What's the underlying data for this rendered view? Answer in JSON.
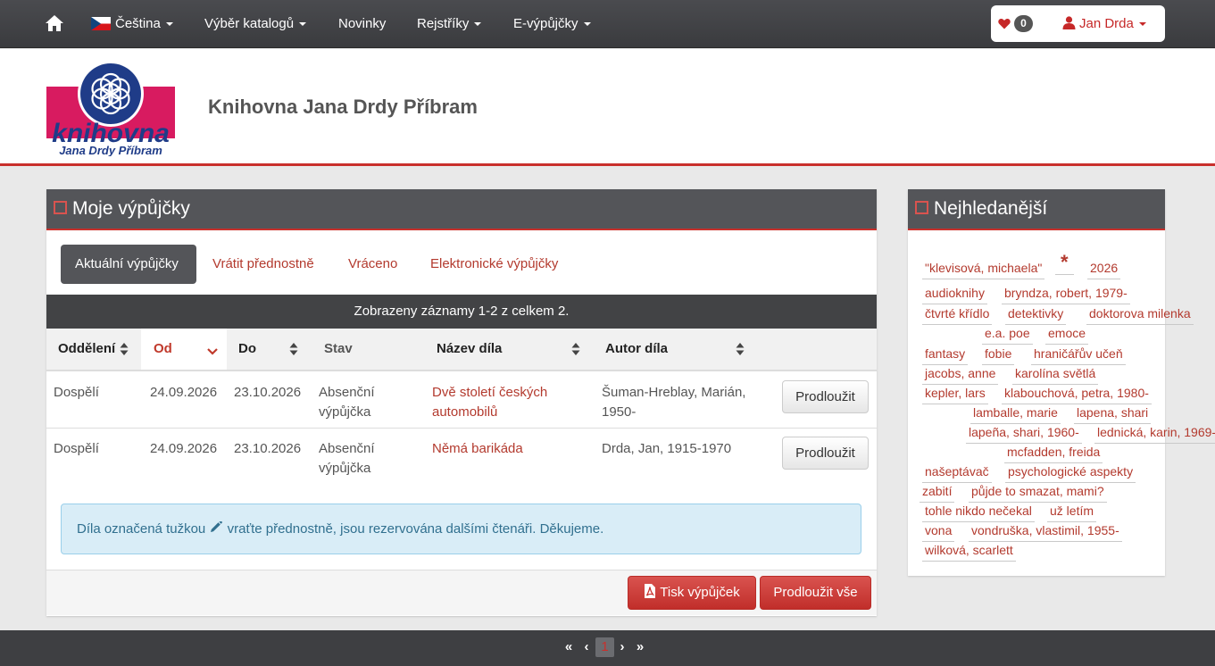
{
  "nav": {
    "language": "Čeština",
    "catalogs": "Výběr katalogů",
    "news": "Novinky",
    "indexes": "Rejstříky",
    "eloans": "E-výpůjčky",
    "favorites_count": "0",
    "user": "Jan Drda"
  },
  "header": {
    "title": "Knihovna Jana Drdy Příbram",
    "logo_text": "knihovna",
    "logo_subtext": "Jana Drdy Příbram"
  },
  "loans": {
    "panel_title": "Moje výpůjčky",
    "tabs": [
      "Aktuální výpůjčky",
      "Vrátit přednostně",
      "Vráceno",
      "Elektronické výpůjčky"
    ],
    "summary": "Zobrazeny záznamy 1-2 z celkem 2.",
    "columns": [
      "Oddělení",
      "Od",
      "Do",
      "Stav",
      "Název díla",
      "Autor díla"
    ],
    "rows": [
      {
        "dept": "Dospělí",
        "from": "24.09.2026",
        "to": "23.10.2026",
        "status": "Absenční výpůjčka",
        "title": "Dvě století českých automobilů",
        "author": "Šuman-Hreblay, Marián, 1950-",
        "action": "Prodloužit"
      },
      {
        "dept": "Dospělí",
        "from": "24.09.2026",
        "to": "23.10.2026",
        "status": "Absenční výpůjčka",
        "title": "Němá barikáda",
        "author": "Drda, Jan, 1915-1970",
        "action": "Prodloužit"
      }
    ],
    "notice_before": "Díla označená tužkou",
    "notice_after": "vraťte přednostně, jsou rezervována dalšími čtenáři. Děkujeme.",
    "print_button": "Tisk výpůjček",
    "renew_all_button": "Prodloužit vše"
  },
  "popular": {
    "panel_title": "Nejhledanější",
    "tags": [
      "\"klevisová, michaela\"",
      "*",
      "2026",
      "audioknihy",
      "bryndza, robert, 1979-",
      "čtvrté křídlo",
      "detektivky",
      "doktorova milenka",
      "e.a. poe",
      "emoce",
      "fantasy",
      "fobie",
      "hraničářův učeň",
      "jacobs, anne",
      "karolína světlá",
      "kepler, lars",
      "klabouchová, petra, 1980-",
      "lamballe, marie",
      "lapena, shari",
      "lapeña, shari, 1960-",
      "lednická, karin, 1969-",
      "mcfadden, freida",
      "našeptávač",
      "psychologické aspekty",
      "zabití",
      "půjde to smazat, mami?",
      "tohle nikdo nečekal",
      "už letím",
      "vona",
      "vondruška, vlastimil, 1955-",
      "wilková, scarlett"
    ]
  },
  "pagination": {
    "first": "«",
    "prev": "‹",
    "current": "1",
    "next": "›",
    "last": "»"
  },
  "colors": {
    "accent": "#c9302c",
    "link": "#b33a2e",
    "dark": "#545559"
  }
}
